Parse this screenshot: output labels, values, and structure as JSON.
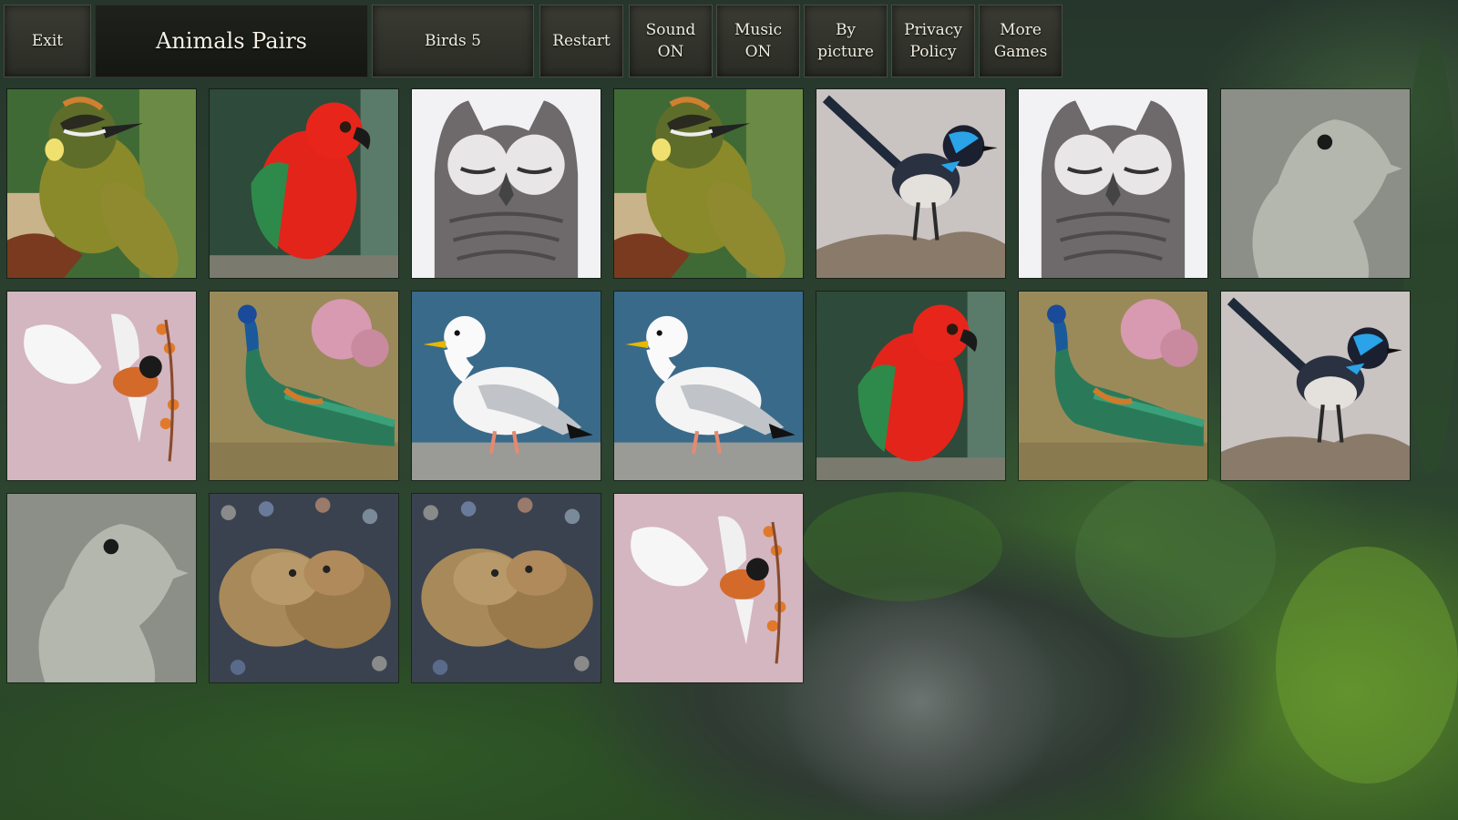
{
  "header": {
    "exit_label": "Exit",
    "title": "Animals Pairs",
    "category_label": "Birds 5",
    "restart_label": "Restart",
    "sound_label": "Sound\nON",
    "music_label": "Music\nON",
    "mode_label": "By\npicture",
    "privacy_label": "Privacy\nPolicy",
    "more_label": "More\nGames"
  },
  "board": {
    "rows": [
      [
        "honeyeater",
        "king-parrot",
        "owl",
        "honeyeater",
        "fairy-wren",
        "owl",
        "dove"
      ],
      [
        "flying-finch",
        "peacock",
        "seagull",
        "seagull",
        "king-parrot",
        "peacock",
        "fairy-wren"
      ],
      [
        "dove",
        "ducklings",
        "ducklings",
        "flying-finch"
      ]
    ]
  },
  "colors": {
    "button_bg": "#2f312a",
    "button_text": "#f0ece0",
    "title_bg": "#1a1c17"
  }
}
